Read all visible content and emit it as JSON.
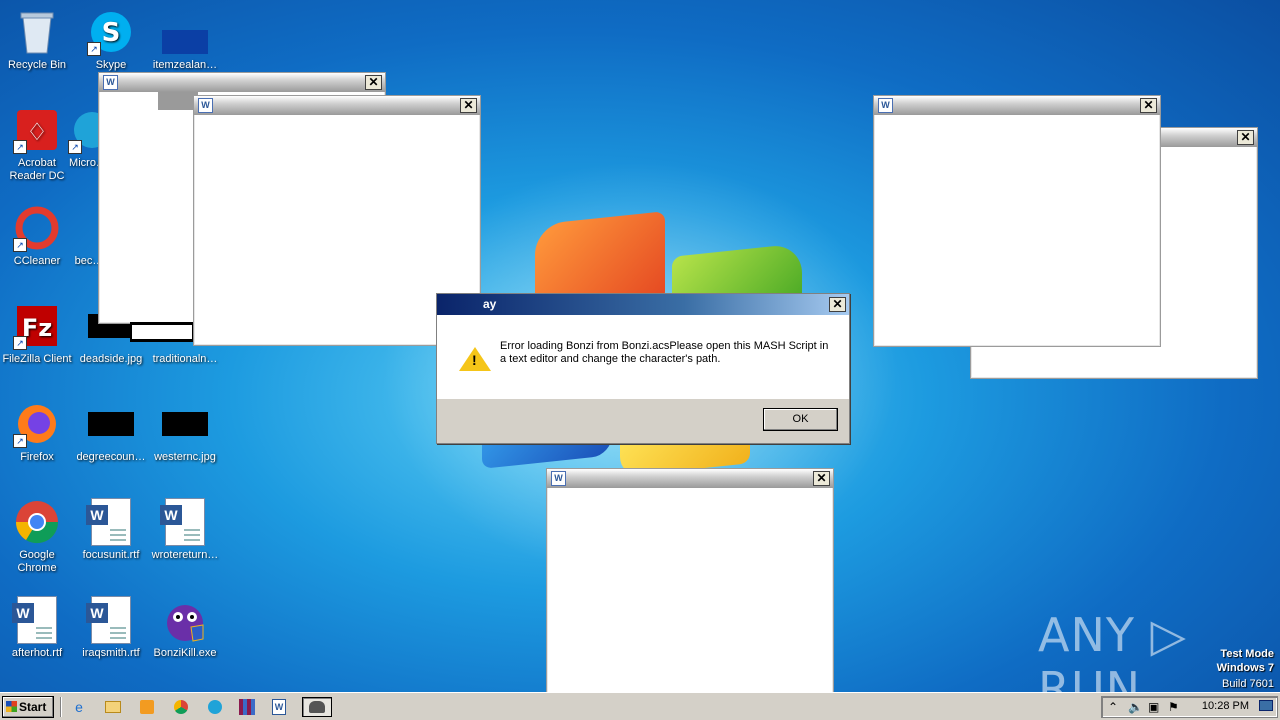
{
  "desktop": {
    "icons": [
      {
        "label": "Recycle Bin",
        "glyph": "recycle-bin-icon"
      },
      {
        "label": "Skype",
        "glyph": "skype-icon"
      },
      {
        "label": "itemzealan…",
        "glyph": "image-thumbnail-icon"
      },
      {
        "label": "Acrobat Reader DC",
        "glyph": "acrobat-icon"
      },
      {
        "label": "Micro…",
        "glyph": "edge-icon"
      },
      {
        "label": "CCleaner",
        "glyph": "ccleaner-icon"
      },
      {
        "label": "bec…",
        "glyph": "image-thumbnail-icon"
      },
      {
        "label": "FileZilla Client",
        "glyph": "filezilla-icon"
      },
      {
        "label": "deadside.jpg",
        "glyph": "image-thumbnail-icon"
      },
      {
        "label": "traditionaln…",
        "glyph": "image-thumbnail-icon"
      },
      {
        "label": "Firefox",
        "glyph": "firefox-icon"
      },
      {
        "label": "degreecoun…",
        "glyph": "image-thumbnail-icon"
      },
      {
        "label": "westernc.jpg",
        "glyph": "image-thumbnail-icon"
      },
      {
        "label": "Google Chrome",
        "glyph": "chrome-icon"
      },
      {
        "label": "focusunit.rtf",
        "glyph": "word-doc-icon"
      },
      {
        "label": "wrotereturn…",
        "glyph": "word-doc-icon"
      },
      {
        "label": "afterhot.rtf",
        "glyph": "word-doc-icon"
      },
      {
        "label": "iraqsmith.rtf",
        "glyph": "word-doc-icon"
      },
      {
        "label": "BonziKill.exe",
        "glyph": "bonzi-icon"
      }
    ]
  },
  "dialog": {
    "title": "ay",
    "message": "Error loading Bonzi from Bonzi.acsPlease open this MASH Script in a text editor and change the character's path.",
    "ok_label": "OK"
  },
  "windows": {
    "close_glyph": "✕",
    "app_glyph": "W"
  },
  "taskbar": {
    "start_label": "Start",
    "clock": "10:28 PM"
  },
  "watermark": {
    "line1": "Test Mode",
    "line2": "Windows 7",
    "line3": "Build 7601",
    "brand": "ANY ▷ RUN"
  }
}
